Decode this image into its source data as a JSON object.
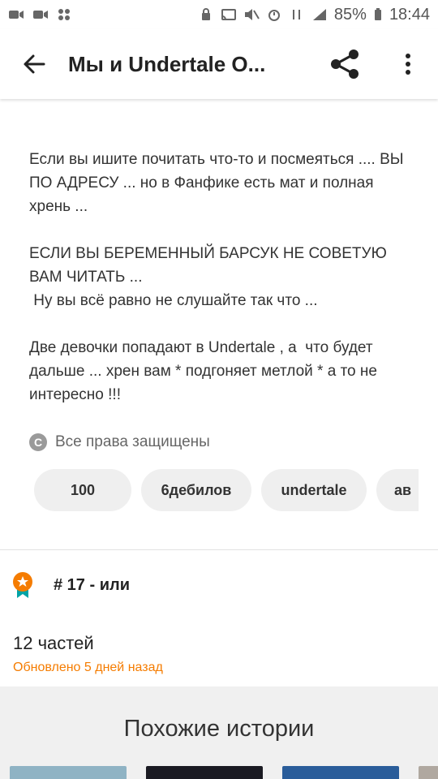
{
  "status_bar": {
    "battery": "85%",
    "time": "18:44"
  },
  "app_bar": {
    "title": "Мы и Undertale О..."
  },
  "description": {
    "text": "Если вы ишите почитать что-то и посмеяться .... ВЫ ПО АДРЕСУ ... но в Фанфике есть мат и полная хрень ...\n\nЕСЛИ ВЫ БЕРЕМЕННЫЙ БАРСУК НЕ СОВЕТУЮ ВАМ ЧИТАТЬ ...\n Ну вы всё равно не слушайте так что ...\n\nДве девочки попадают в Undertale , а  что будет дальше ... хрен вам * подгоняет метлой * а то не интересно !!!"
  },
  "copyright": {
    "icon": "copyright-icon",
    "label": "Все права защищены"
  },
  "tags": [
    "100",
    "6дебилов",
    "undertale",
    "ав"
  ],
  "rank": {
    "icon": "ranking-badge-icon",
    "label": "# 17 - или"
  },
  "parts": {
    "count_label": "12 частей",
    "updated_label": "Обновлено 5 дней назад"
  },
  "similar": {
    "title": "Похожие истории"
  },
  "colors": {
    "accent": "#f57c00",
    "tag_bg": "#efefef",
    "similar_bg": "#f0f0f0"
  }
}
